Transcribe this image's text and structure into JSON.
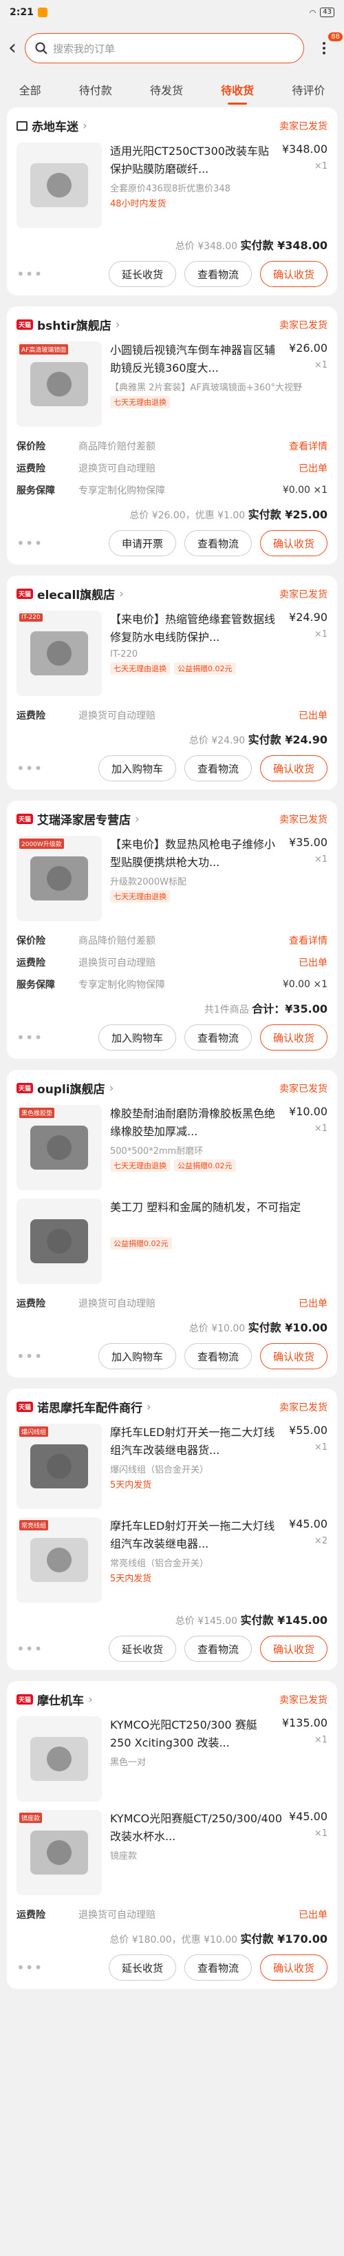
{
  "status_bar": {
    "time": "2:21",
    "battery": "43"
  },
  "search": {
    "placeholder": "搜索我的订单",
    "badge": "88"
  },
  "tabs": [
    {
      "label": "全部"
    },
    {
      "label": "待付款"
    },
    {
      "label": "待发货"
    },
    {
      "label": "待收货"
    },
    {
      "label": "待评价"
    }
  ],
  "accent": "#f34b16",
  "orders": [
    {
      "shop": "赤地车迷",
      "status": "卖家已发货",
      "items": [
        {
          "title": "适用光阳CT250CT300改装车贴保护贴膜防磨碳纤...",
          "price": "¥348.00",
          "qty": "×1",
          "sku": "全套原价436现8折优惠价348",
          "note": "48小时内发货"
        }
      ],
      "total_a": "总价 ¥348.00",
      "total_b": "实付款 ¥348.00",
      "buttons": {
        "b1": "延长收货",
        "b2": "查看物流",
        "b3": "确认收货"
      }
    },
    {
      "shop": "bshtir旗舰店",
      "status": "卖家已发货",
      "items": [
        {
          "title": "小圆镜后视镜汽车倒车神器盲区辅助镜反光镜360度大...",
          "price": "¥26.00",
          "qty": "×1",
          "sku": "【典雅黑 2片套装】AF真玻璃镜面+360°大视野",
          "tag": "七天无理由退换",
          "img_label": "AF高清玻璃镜面"
        }
      ],
      "services": [
        {
          "k": "保价险",
          "v": "商品降价赔付差额",
          "r": "查看详情"
        },
        {
          "k": "运费险",
          "v": "退换货可自动理赔",
          "r": "已出单"
        },
        {
          "k": "服务保障",
          "v": "专享定制化购物保障",
          "r": "¥0.00 ×1"
        }
      ],
      "total_a": "总价 ¥26.00，优惠 ¥1.00",
      "total_b": "实付款 ¥25.00",
      "buttons": {
        "b1": "申请开票",
        "b2": "查看物流",
        "b3": "确认收货"
      }
    },
    {
      "shop": "elecall旗舰店",
      "status": "卖家已发货",
      "items": [
        {
          "title": "【来电价】热缩管绝缘套管数据线修复防水电线防保护...",
          "price": "¥24.90",
          "qty": "×1",
          "sku": "IT-220",
          "tag": "七天无理由退换",
          "tag2": "公益捐赠0.02元",
          "img_label": "IT-220"
        }
      ],
      "services": [
        {
          "k": "运费险",
          "v": "退换货可自动理赔",
          "r": "已出单"
        }
      ],
      "total_a": "总价 ¥24.90",
      "total_b": "实付款 ¥24.90",
      "buttons": {
        "b1": "加入购物车",
        "b2": "查看物流",
        "b3": "确认收货"
      }
    },
    {
      "shop": "艾瑞泽家居专营店",
      "status": "卖家已发货",
      "items": [
        {
          "title": "【来电价】数显热风枪电子维修小型贴膜便携烘枪大功...",
          "price": "¥35.00",
          "qty": "×1",
          "sku": "升级款2000W标配",
          "tag": "七天无理由退换",
          "img_label": "2000W升级款"
        }
      ],
      "services": [
        {
          "k": "保价险",
          "v": "商品降价赔付差额",
          "r": "查看详情"
        },
        {
          "k": "运费险",
          "v": "退换货可自动理赔",
          "r": "已出单"
        },
        {
          "k": "服务保障",
          "v": "专享定制化购物保障",
          "r": "¥0.00 ×1"
        }
      ],
      "total_a": "共1件商品",
      "total_b": "合计：¥35.00",
      "buttons": {
        "b1": "加入购物车",
        "b2": "查看物流",
        "b3": "确认收货"
      }
    },
    {
      "shop": "oupli旗舰店",
      "status": "卖家已发货",
      "items": [
        {
          "title": "橡胶垫耐油耐磨防滑橡胶板黑色绝缘橡胶垫加厚减...",
          "price": "¥10.00",
          "qty": "×1",
          "sku": "500*500*2mm耐磨环",
          "tag": "七天无理由退换",
          "tag2": "公益捐赠0.02元",
          "img_label": "黑色橡胶垫"
        },
        {
          "title": "美工刀 塑料和金属的随机发，不可指定",
          "price": "",
          "qty": "",
          "sku": "",
          "tag2": "公益捐赠0.02元"
        }
      ],
      "services": [
        {
          "k": "运费险",
          "v": "退换货可自动理赔",
          "r": "已出单"
        }
      ],
      "total_a": "总价 ¥10.00",
      "total_b": "实付款 ¥10.00",
      "buttons": {
        "b1": "加入购物车",
        "b2": "查看物流",
        "b3": "确认收货"
      }
    },
    {
      "shop": "诺思摩托车配件商行",
      "status": "卖家已发货",
      "items": [
        {
          "title": "摩托车LED射灯开关一拖二大灯线组汽车改装继电器货...",
          "price": "¥55.00",
          "qty": "×1",
          "sku": "爆闪线组（铝合金开关）",
          "note": "5天内发货",
          "img_label": "爆闪线组"
        },
        {
          "title": "摩托车LED射灯开关一拖二大灯线组汽车改装继电器...",
          "price": "¥45.00",
          "qty": "×2",
          "sku": "常亮线组（铝合金开关）",
          "note": "5天内发货",
          "img_label": "常亮线组"
        }
      ],
      "total_a": "总价 ¥145.00",
      "total_b": "实付款 ¥145.00",
      "buttons": {
        "b1": "延长收货",
        "b2": "查看物流",
        "b3": "确认收货"
      }
    },
    {
      "shop": "摩仕机车",
      "status": "卖家已发货",
      "items": [
        {
          "title": "KYMCO光阳CT250/300 赛艇250 Xciting300 改装...",
          "price": "¥135.00",
          "qty": "×1",
          "sku": "黑色一对"
        },
        {
          "title": "KYMCO光阳赛艇CT/250/300/400改装水杯水...",
          "price": "¥45.00",
          "qty": "×1",
          "sku": "镜座款",
          "img_label": "镜座款"
        }
      ],
      "services": [
        {
          "k": "运费险",
          "v": "退换货可自动理赔",
          "r": "已出单"
        }
      ],
      "total_a": "总价 ¥180.00，优惠 ¥10.00",
      "total_b": "实付款 ¥170.00",
      "buttons": {
        "b1": "延长收货",
        "b2": "查看物流",
        "b3": "确认收货"
      }
    }
  ]
}
